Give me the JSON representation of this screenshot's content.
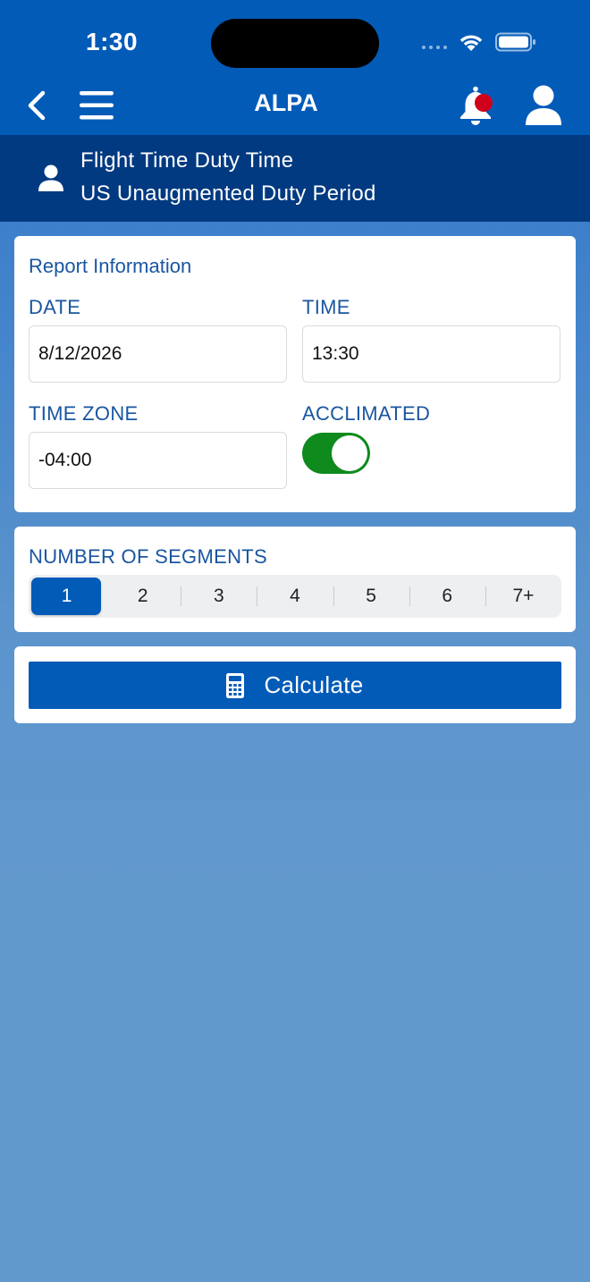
{
  "status_bar": {
    "time": "1:30"
  },
  "nav": {
    "title": "ALPA"
  },
  "header": {
    "title": "Flight Time Duty Time",
    "subtitle": "US Unaugmented Duty Period"
  },
  "report": {
    "section_title": "Report Information",
    "date_label": "DATE",
    "date_value": "8/12/2026",
    "time_label": "TIME",
    "time_value": "13:30",
    "timezone_label": "TIME ZONE",
    "timezone_value": "-04:00",
    "acclimated_label": "ACCLIMATED",
    "acclimated_on": true
  },
  "segments": {
    "label": "NUMBER OF SEGMENTS",
    "options": [
      "1",
      "2",
      "3",
      "4",
      "5",
      "6",
      "7+"
    ],
    "selected": "1"
  },
  "actions": {
    "calculate_label": "Calculate"
  },
  "colors": {
    "primary": "#035bb8",
    "header_dark": "#023a81",
    "toggle_on": "#0f8a1d",
    "notification_dot": "#d0021b"
  },
  "icons": {
    "back": "chevron-left-icon",
    "menu": "hamburger-menu-icon",
    "notifications": "bell-icon",
    "profile": "user-icon",
    "header": "user-icon",
    "calculate": "calculator-icon"
  }
}
